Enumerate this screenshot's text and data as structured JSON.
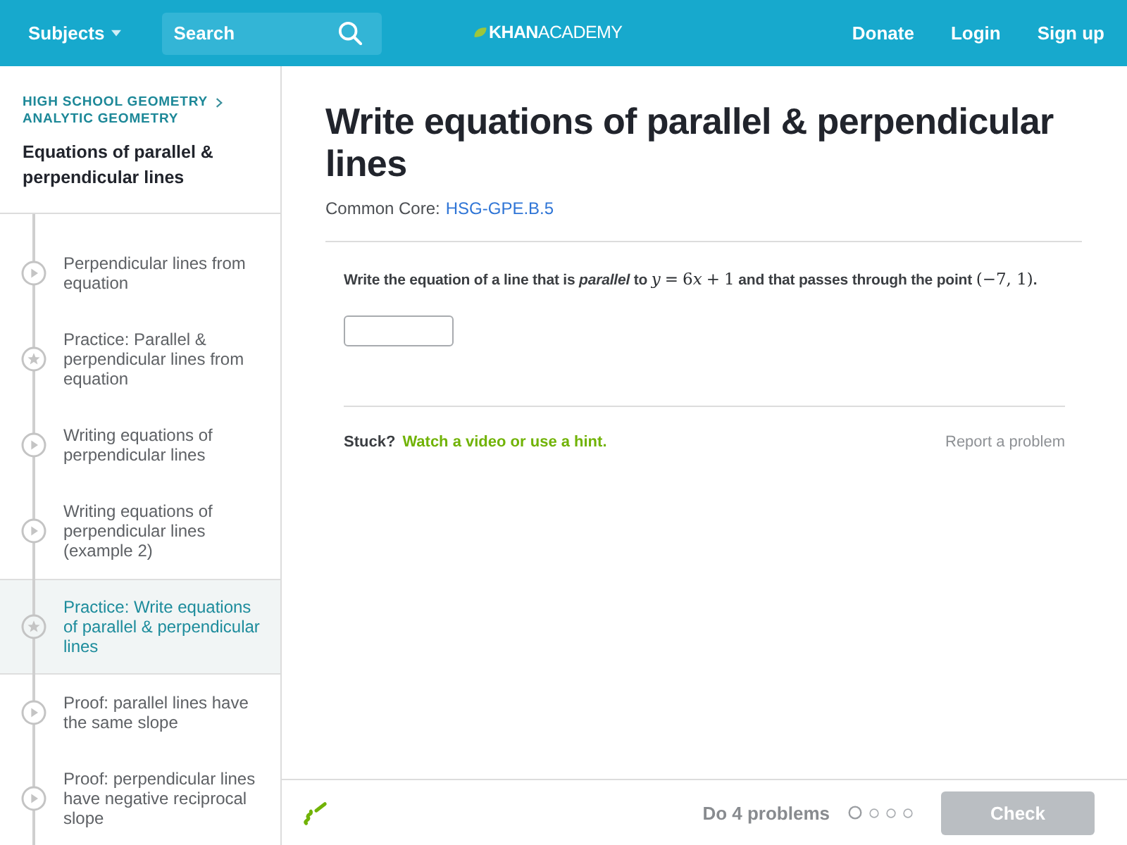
{
  "header": {
    "subjects": "Subjects",
    "search": {
      "placeholder": "Search"
    },
    "logo": "**KHAN**ACADEMY",
    "links": [
      "Donate",
      "Login",
      "Sign up"
    ]
  },
  "sidebar": {
    "breadcrumbs": [
      "HIGH SCHOOL GEOMETRY",
      "ANALYTIC GEOMETRY"
    ],
    "title": "Equations of parallel & perpendicular lines",
    "items": [
      {
        "kind": "video",
        "label": "Perpendicular lines from equation",
        "selected": false
      },
      {
        "kind": "exercise",
        "label": "Practice: Parallel & perpendicular lines from equation",
        "selected": false
      },
      {
        "kind": "video",
        "label": "Writing equations of perpendicular lines",
        "selected": false
      },
      {
        "kind": "video",
        "label": "Writing equations of perpendicular lines (example 2)",
        "selected": false
      },
      {
        "kind": "exercise",
        "label": "Practice: Write equations of parallel & perpendicular lines",
        "selected": true
      },
      {
        "kind": "video",
        "label": "Proof: parallel lines have the same slope",
        "selected": false
      },
      {
        "kind": "video",
        "label": "Proof: perpendicular lines have negative reciprocal slope",
        "selected": false
      }
    ]
  },
  "main": {
    "title": "Write equations of parallel & perpendicular lines",
    "standard": {
      "label": "Common Core:",
      "code": "HSG-GPE.B.5"
    },
    "question": [
      {
        "kind": "text",
        "text": "Write the equation of a line that is *parallel* to "
      },
      {
        "kind": "math",
        "tokens": [
          {
            "kind": "var",
            "text": "y"
          },
          {
            "kind": "op",
            "text": "="
          },
          {
            "kind": "num",
            "text": "6"
          },
          {
            "kind": "var",
            "text": "x"
          },
          {
            "kind": "op",
            "text": "+"
          },
          {
            "kind": "num",
            "text": "1"
          }
        ]
      },
      {
        "kind": "text",
        "text": " and that passes through the point "
      },
      {
        "kind": "math",
        "tokens": [
          {
            "kind": "num",
            "text": "(−7, 1)"
          }
        ]
      },
      {
        "kind": "text",
        "text": "."
      }
    ],
    "stuck": {
      "label": "Stuck?",
      "link": "Watch a video or use a hint.",
      "report": "Report a problem"
    }
  },
  "footer": {
    "task": "Do 4 problems",
    "progress": [
      {
        "selected": true
      },
      {
        "selected": false
      },
      {
        "selected": false
      },
      {
        "selected": false
      }
    ],
    "button": {
      "label": "Check",
      "disabled": true
    }
  }
}
